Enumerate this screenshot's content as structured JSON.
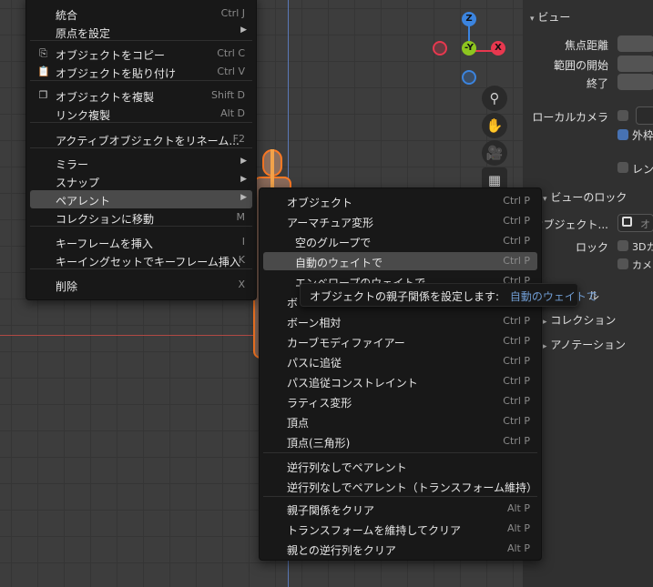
{
  "left_menu": {
    "items": [
      {
        "label": "統合",
        "shortcut": "Ctrl J"
      },
      {
        "label": "原点を設定",
        "submenu": true
      },
      {
        "label": "オブジェクトをコピー",
        "shortcut": "Ctrl C",
        "icon": "copy-icon"
      },
      {
        "label": "オブジェクトを貼り付け",
        "shortcut": "Ctrl V",
        "icon": "paste-icon"
      },
      {
        "label": "オブジェクトを複製",
        "shortcut": "Shift D",
        "icon": "duplicate-icon"
      },
      {
        "label": "リンク複製",
        "shortcut": "Alt D"
      },
      {
        "label": "アクティブオブジェクトをリネーム...",
        "shortcut": "F2"
      },
      {
        "label": "ミラー",
        "submenu": true
      },
      {
        "label": "スナップ",
        "submenu": true
      },
      {
        "label": "ペアレント",
        "submenu": true,
        "active": true
      },
      {
        "label": "コレクションに移動",
        "shortcut": "M"
      },
      {
        "label": "キーフレームを挿入",
        "shortcut": "I"
      },
      {
        "label": "キーイングセットでキーフレーム挿入",
        "shortcut": "K"
      },
      {
        "label": "削除",
        "shortcut": "X"
      }
    ]
  },
  "parent_menu": {
    "items": [
      {
        "label": "オブジェクト",
        "shortcut": "Ctrl P"
      },
      {
        "label": "アーマチュア変形",
        "shortcut": "Ctrl P"
      },
      {
        "label": "空のグループで",
        "shortcut": "Ctrl P"
      },
      {
        "label": "自動のウェイトで",
        "shortcut": "Ctrl P",
        "active": true
      },
      {
        "label": "エンベロープのウェイトで",
        "shortcut": "Ctrl P"
      },
      {
        "label": "ボ",
        "shortcut": "Ctrl P"
      },
      {
        "label": "ボーン相対",
        "shortcut": "Ctrl P"
      },
      {
        "label": "カーブモディファイアー",
        "shortcut": "Ctrl P"
      },
      {
        "label": "パスに追従",
        "shortcut": "Ctrl P"
      },
      {
        "label": "パス追従コンストレイント",
        "shortcut": "Ctrl P"
      },
      {
        "label": "ラティス変形",
        "shortcut": "Ctrl P"
      },
      {
        "label": "頂点",
        "shortcut": "Ctrl P"
      },
      {
        "label": "頂点(三角形)",
        "shortcut": "Ctrl P"
      },
      {
        "label": "逆行列なしでペアレント",
        "shortcut": ""
      },
      {
        "label": "逆行列なしでペアレント（トランスフォーム維持）",
        "shortcut": ""
      },
      {
        "label": "親子関係をクリア",
        "shortcut": "Alt P"
      },
      {
        "label": "トランスフォームを維持してクリア",
        "shortcut": "Alt P"
      },
      {
        "label": "親との逆行列をクリア",
        "shortcut": "Alt P"
      }
    ]
  },
  "tooltip": {
    "text": "オブジェクトの親子関係を設定します:",
    "highlight": "自動のウェイトで"
  },
  "gizmo": {
    "z": "Z",
    "y": "-Y",
    "x": "X"
  },
  "right_panel": {
    "view_header": "ビュー",
    "focal_length": "焦点距離",
    "clip_start": "範囲の開始",
    "clip_end": "終了",
    "local_camera": "ローカルカメラ",
    "outline_partial": "外枠",
    "render_partial": "レン",
    "view_lock_header": "ビューのロック",
    "lock_object": "オブジェクト...",
    "lock_object_value": "オ",
    "lock": "ロック",
    "lock_3d_partial": "3Dカ",
    "lock_camera_partial": "カメ",
    "partial_l": "ル",
    "collection": "コレクション",
    "annotation": "アノテーション"
  },
  "colors": {
    "axis_x": "#e8384f",
    "axis_y": "#8dc51f",
    "axis_z": "#3b84df",
    "selection_outline": "#ff7a24",
    "tooltip_highlight": "#6f9bd1"
  }
}
